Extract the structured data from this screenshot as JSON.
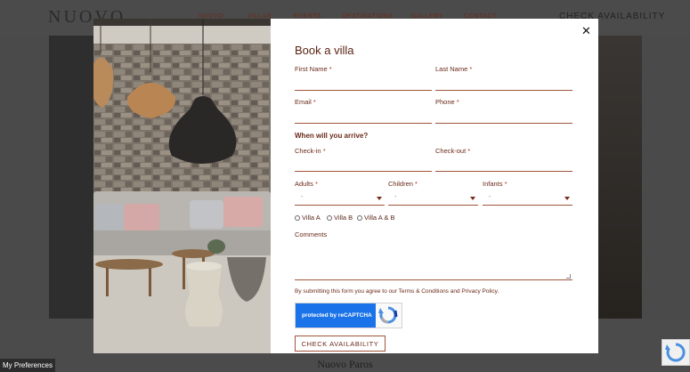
{
  "site": {
    "logo": "NUOVO",
    "nav": [
      "NUOVO",
      "VILLAS",
      "EVENTS",
      "DESTINATIONS",
      "GALLERY",
      "CONTACT"
    ],
    "check_availability": "CHECK AVAILABILITY",
    "below_text": "Nuovo Paros",
    "preferences": "My Preferences"
  },
  "modal": {
    "title": "Book a villa",
    "close_icon": "close-icon",
    "fields": {
      "first_name": "First Name",
      "last_name": "Last Name",
      "email": "Email",
      "phone": "Phone",
      "when_question": "When will you arrive?",
      "checkin": "Check-in",
      "checkout": "Check-out",
      "adults": "Adults",
      "children": "Children",
      "infants": "Infants",
      "select_placeholder": "-",
      "required_mark": "*"
    },
    "villas": [
      "Villa A",
      "Villa B",
      "Villa A & B"
    ],
    "comments": "Comments",
    "consent": "By submitting this form you agree to our Terms & Conditions and Privacy Policy.",
    "recaptcha": "protected by reCAPTCHA",
    "submit": "CHECK AVAILABILITY"
  },
  "colors": {
    "accent": "#a0553a",
    "text": "#6a2a18",
    "recaptcha_blue": "#1a73e8"
  }
}
